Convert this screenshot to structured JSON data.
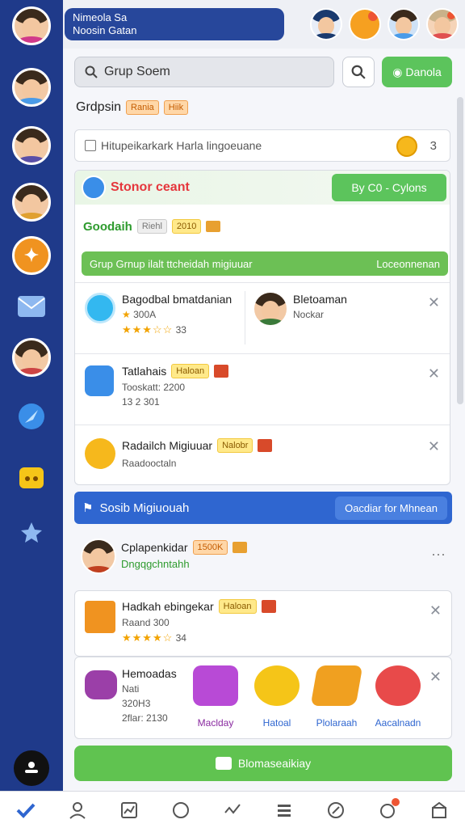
{
  "header": {
    "line1": "Nimeola Sa",
    "line2": "Noosin Gatan"
  },
  "search": {
    "placeholder": "Grup Soem",
    "action_label": "Danola"
  },
  "title": {
    "text": "Grdpsin",
    "tag1": "Rania",
    "tag2": "Hiik"
  },
  "notice": {
    "text": "Hitupeikarkark Harla lingoeuane",
    "count": "3"
  },
  "section": {
    "title": "Stonor ceant",
    "button": "By C0 - Cylons",
    "sub_title": "Goodaih",
    "sub_tag1": "Riehl",
    "sub_tag2": "2010",
    "bar_text": "Grup Grnup ilalt ttcheidah migiuuar",
    "bar_right": "Loceonnenan"
  },
  "rows": [
    {
      "title": "Bagodbal bmatdanian",
      "sub": "300A",
      "stars": "★★★☆☆",
      "count": "33",
      "right_title": "Bletoaman",
      "right_sub": "Nockar"
    },
    {
      "title": "Tatlahais",
      "tag": "Haloan",
      "sub": "Tooskatt: 2200",
      "meta": "13 2 301"
    },
    {
      "title": "Radailch Migiuuar",
      "tag": "Nalobr",
      "sub": "Raadooctaln"
    }
  ],
  "banner": {
    "left": "Sosib Migiuouah",
    "right": "Oacdiar for Mhnean"
  },
  "feature": {
    "title": "Cplapenkidar",
    "tag": "1500K",
    "sub": "Dngqgchntahh"
  },
  "card2": {
    "title": "Hadkah ebingekar",
    "tag": "Haloan",
    "sub": "Raand 300",
    "stars": "★★★★☆",
    "count": "34"
  },
  "card3": {
    "title": "Hemoadas",
    "sub1": "Nati",
    "sub2": "320H3",
    "sub3": "2flar: 2130",
    "gifts": [
      "Maclday",
      "Hatoal",
      "Plolaraah",
      "Aacalnadn"
    ]
  },
  "cta": {
    "label": "Blomaseaikiay"
  },
  "colors": {
    "rail": "#1f3a8a",
    "green": "#5cc45c",
    "blue": "#2f66d0",
    "red": "#e5363c"
  }
}
